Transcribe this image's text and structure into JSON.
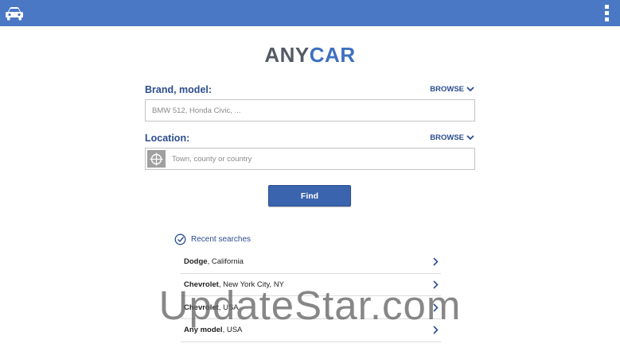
{
  "app": {
    "logo_part1": "ANY",
    "logo_part2": "CAR",
    "car_icon": "car-icon",
    "menu_icon": "overflow-menu-icon",
    "accent": "#4a78c5"
  },
  "form": {
    "brand_label": "Brand, model:",
    "brand_placeholder": "BMW 512, Honda Civic, ...",
    "brand_browse": "BROWSE",
    "location_label": "Location:",
    "location_placeholder": "Town, county or country",
    "location_browse": "BROWSE",
    "find_label": "Find"
  },
  "recent": {
    "title": "Recent searches",
    "items": [
      {
        "brand": "Dodge",
        "place": ", California"
      },
      {
        "brand": "Chevrolet",
        "place": ", New York City, NY"
      },
      {
        "brand": "Chevrolet",
        "place": ", USA"
      },
      {
        "brand": "Any model",
        "place": ", USA"
      }
    ]
  },
  "watermark": "UpdateStar.com"
}
